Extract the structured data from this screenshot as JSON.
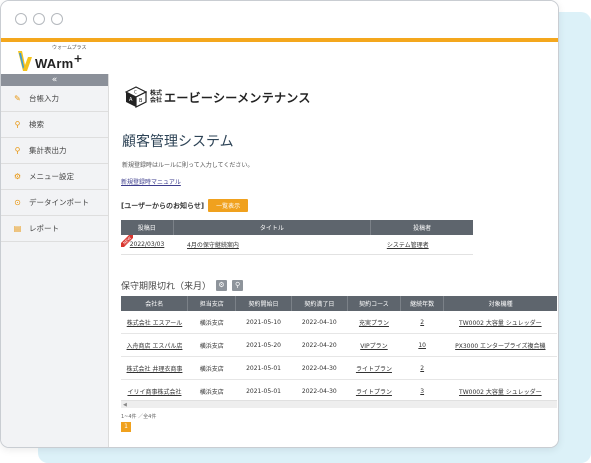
{
  "app": {
    "logo_sub": "ウォームプラス",
    "logo_word": "WArm",
    "logo_plus": "+"
  },
  "sidebar": {
    "collapse_label": "«",
    "items": [
      {
        "label": "台帳入力",
        "icon": "pencil-icon"
      },
      {
        "label": "検索",
        "icon": "search-icon"
      },
      {
        "label": "集計表出力",
        "icon": "search-icon"
      },
      {
        "label": "メニュー設定",
        "icon": "gear-icon"
      },
      {
        "label": "データインポート",
        "icon": "import-icon"
      },
      {
        "label": "レポート",
        "icon": "document-icon"
      }
    ]
  },
  "company": {
    "small_top": "株式",
    "small_bottom": "会社",
    "name": "エービーシーメンテナンス"
  },
  "main": {
    "title": "顧客管理システム",
    "intro": "新規登録時はルールに則って入力してください。",
    "manual_link": "新規登録時マニュアル"
  },
  "notices": {
    "label": "[ユーザーからのお知らせ]",
    "list_button": "一覧表示",
    "columns": [
      "投稿日",
      "タイトル",
      "投稿者"
    ],
    "rows": [
      {
        "badge": "NEW",
        "date": "2022/03/03",
        "title": "4月の保守継続案内",
        "author": "システム管理者"
      }
    ]
  },
  "maintenance": {
    "label": "保守期限切れ（来月）",
    "columns": [
      "会社名",
      "担当支店",
      "契約開始日",
      "契約満了日",
      "契約コース",
      "継続年数",
      "対象機種"
    ],
    "rows": [
      {
        "company": "株式会社 エスアール",
        "branch": "横浜支店",
        "start": "2021-05-10",
        "end": "2022-04-10",
        "course": "充実プラン",
        "years": "2",
        "model": "TW0002 大容量 シュレッダー"
      },
      {
        "company": "入舟商店 エスパル店",
        "branch": "横浜支店",
        "start": "2021-05-20",
        "end": "2022-04-20",
        "course": "VIPプラン",
        "years": "10",
        "model": "PX3000 エンタープライズ複合機"
      },
      {
        "company": "株式会社 井理衣商事",
        "branch": "横浜支店",
        "start": "2021-05-01",
        "end": "2022-04-30",
        "course": "ライトプラン",
        "years": "2",
        "model": ""
      },
      {
        "company": "イリイ商事株式会社",
        "branch": "横浜支店",
        "start": "2021-05-01",
        "end": "2022-04-30",
        "course": "ライトプラン",
        "years": "3",
        "model": "TW0002 大容量 シュレッダー"
      }
    ],
    "page_count": "1~4件 ／全4件",
    "page_number": "1"
  },
  "colors": {
    "accent": "#f4a71d",
    "header_gray": "#5e656d",
    "sidebar_bg": "#f2f3f5",
    "backdrop": "#dcf1f8"
  }
}
